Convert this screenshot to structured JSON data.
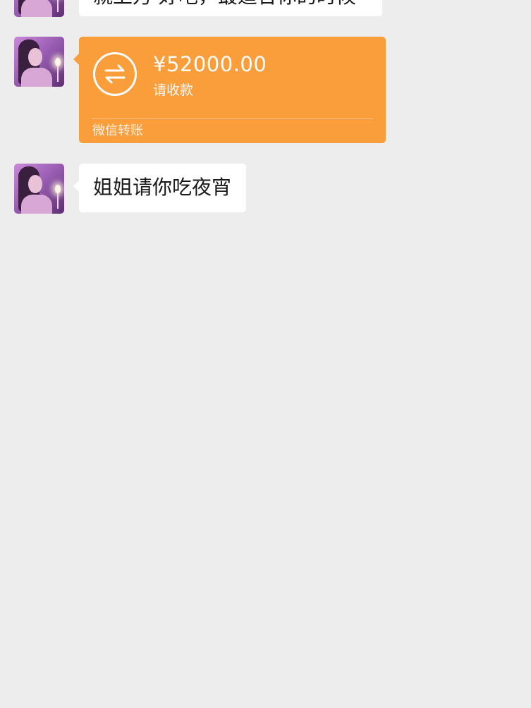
{
  "messages": {
    "top_partial_text": "就上万 好吧，最适合你的时候",
    "transfer": {
      "amount": "¥52000.00",
      "status": "请收款",
      "footer": "微信转账",
      "color": "#fa9d3b",
      "icon": "transfer-arrows-icon"
    },
    "text_message": "姐姐请你吃夜宵"
  },
  "colors": {
    "background": "#ededed",
    "bubble": "#ffffff",
    "text": "#191919"
  }
}
